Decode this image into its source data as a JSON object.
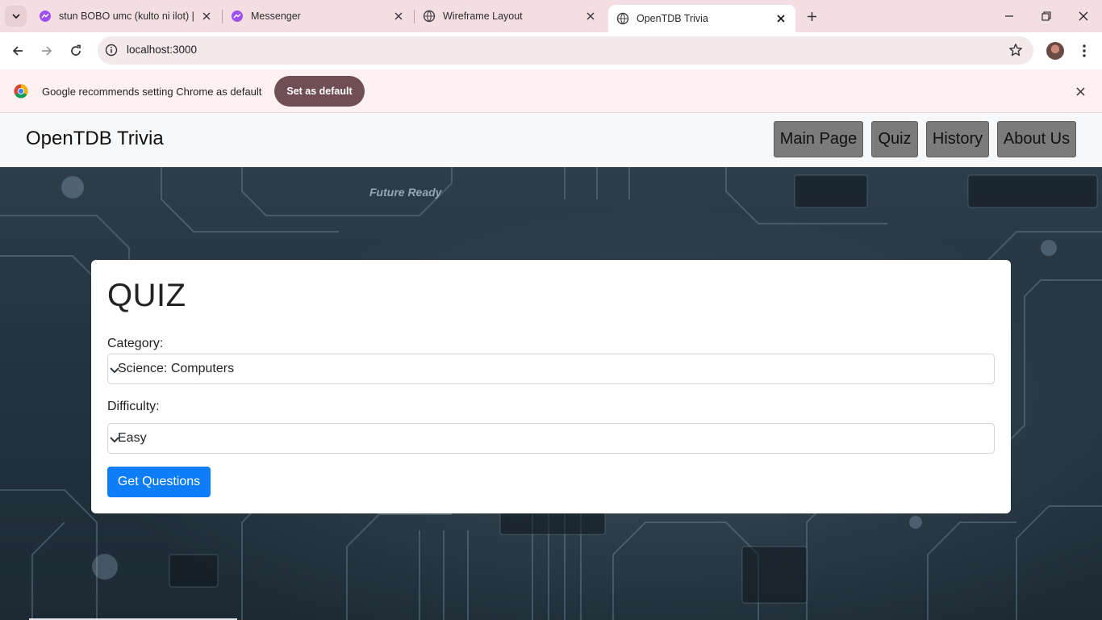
{
  "browser": {
    "tabs": [
      {
        "title": "stun BOBO umc (kulto ni ilot) | M",
        "icon": "messenger-icon",
        "active": false
      },
      {
        "title": "Messenger",
        "icon": "messenger-icon",
        "active": false
      },
      {
        "title": "Wireframe Layout",
        "icon": "globe-icon",
        "active": false
      },
      {
        "title": "OpenTDB Trivia",
        "icon": "globe-icon",
        "active": true
      }
    ],
    "url": "localhost:3000",
    "infobar": {
      "message": "Google recommends setting Chrome as default",
      "button_label": "Set as default"
    }
  },
  "site": {
    "brand": "OpenTDB Trivia",
    "nav": [
      {
        "label": "Main Page"
      },
      {
        "label": "Quiz"
      },
      {
        "label": "History"
      },
      {
        "label": "About Us"
      }
    ]
  },
  "quiz": {
    "title": "QUIZ",
    "category_label": "Category:",
    "category_value": "Science: Computers",
    "difficulty_label": "Difficulty:",
    "difficulty_value": "Easy",
    "submit_label": "Get Questions"
  },
  "background": {
    "caption": "Future Ready"
  },
  "colors": {
    "accent": "#0d7ef8",
    "tab_strip": "#f3dfe3",
    "infobar_button": "#6f4e54",
    "nav_button": "#7b7b7b"
  }
}
